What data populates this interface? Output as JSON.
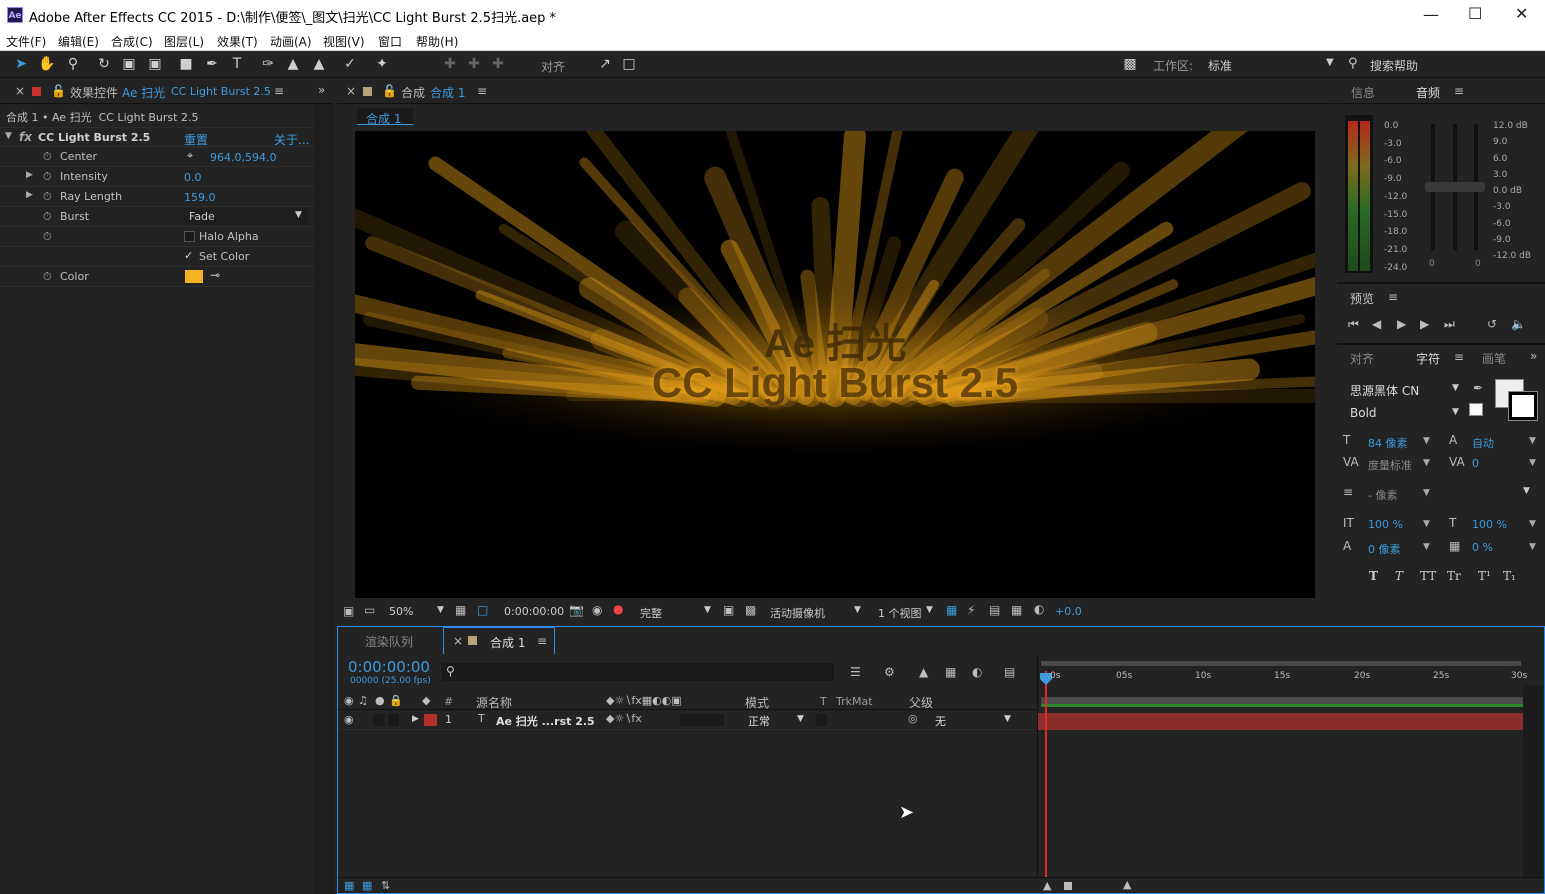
{
  "window": {
    "title": "Adobe After Effects CC 2015 - D:\\制作\\便签\\_图文\\扫光\\CC Light Burst 2.5扫光.aep *",
    "logo": "Ae"
  },
  "menu": [
    "文件(F)",
    "编辑(E)",
    "合成(C)",
    "图层(L)",
    "效果(T)",
    "动画(A)",
    "视图(V)",
    "窗口",
    "帮助(H)"
  ],
  "toolbar": {
    "snap": "对齐",
    "workspace_label": "工作区:",
    "workspace_value": "标准",
    "search_help": "搜索帮助"
  },
  "effects_panel": {
    "tab_prefix": "效果控件",
    "tab_layer": "Ae 扫光",
    "tab_effect": "CC Light Burst 2.5",
    "breadcrumb": "合成 1 • Ae 扫光",
    "breadcrumb_effect": "CC Light Burst 2.5",
    "effect_name": "CC Light Burst 2.5",
    "reset": "重置",
    "about": "关于...",
    "props": {
      "center": {
        "name": "Center",
        "value": "964.0,594.0"
      },
      "intensity": {
        "name": "Intensity",
        "value": "0.0"
      },
      "ray_length": {
        "name": "Ray Length",
        "value": "159.0"
      },
      "burst": {
        "name": "Burst",
        "value": "Fade"
      },
      "halo_alpha": {
        "label": "Halo Alpha",
        "checked": false
      },
      "set_color": {
        "label": "Set Color",
        "checked": true
      },
      "color": {
        "name": "Color",
        "swatch": "#f5b323"
      }
    }
  },
  "viewer": {
    "tab_label": "合成",
    "tab_comp": "合成 1",
    "subtab": "合成 1",
    "comp_text_line1": "Ae 扫光",
    "comp_text_line2": "CC Light Burst 2.5",
    "zoom": "50%",
    "timecode": "0:00:00:00",
    "quality": "完整",
    "camera": "活动摄像机",
    "views": "1 个视图",
    "exposure": "+0.0"
  },
  "info_panel": {
    "tab_info": "信息",
    "tab_audio": "音频",
    "left_scale": [
      "0.0",
      "-3.0",
      "-6.0",
      "-9.0",
      "-12.0",
      "-15.0",
      "-18.0",
      "-21.0",
      "-24.0"
    ],
    "right_scale": [
      "12.0 dB",
      "9.0",
      "6.0",
      "3.0",
      "0.0 dB",
      "-3.0",
      "-6.0",
      "-9.0",
      "-12.0 dB"
    ],
    "slider_left": "0",
    "slider_right": "0"
  },
  "preview_panel": {
    "title": "预览"
  },
  "char_panel": {
    "tab_align": "对齐",
    "tab_char": "字符",
    "tab_paint": "画笔",
    "font": "思源黑体 CN",
    "style": "Bold",
    "size": "84 像素",
    "leading": "自动",
    "kerning": "度量标准",
    "tracking": "0",
    "stroke": "- 像素",
    "vscale": "100 %",
    "hscale": "100 %",
    "baseline": "0 像素",
    "tsume": "0 %",
    "styles": [
      "T",
      "T",
      "TT",
      "Tr",
      "T¹",
      "T₁"
    ]
  },
  "timeline": {
    "tab_render": "渲染队列",
    "tab_comp": "合成 1",
    "timecode": "0:00:00:00",
    "fps": "00000 (25.00 fps)",
    "cols": {
      "num": "#",
      "source": "源名称",
      "mode": "模式",
      "t": "T",
      "trkmat": "TrkMat",
      "parent": "父级"
    },
    "layer": {
      "index": "1",
      "name": "Ae 扫光 ...rst 2.5",
      "mode": "正常",
      "parent": "无",
      "color": "#b3302b"
    },
    "ruler": [
      "0s",
      "05s",
      "10s",
      "15s",
      "20s",
      "25s",
      "30s"
    ]
  }
}
